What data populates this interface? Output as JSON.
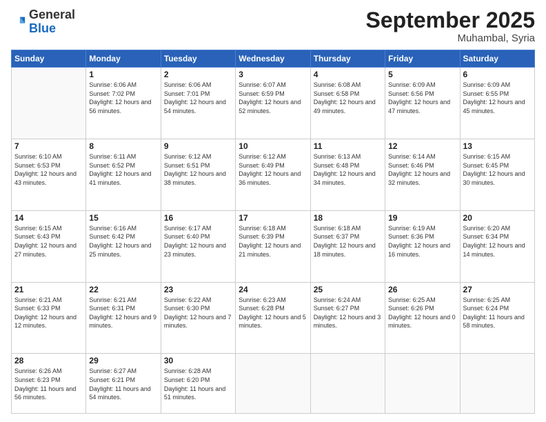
{
  "logo": {
    "general": "General",
    "blue": "Blue"
  },
  "header": {
    "month": "September 2025",
    "location": "Muhambal, Syria"
  },
  "weekdays": [
    "Sunday",
    "Monday",
    "Tuesday",
    "Wednesday",
    "Thursday",
    "Friday",
    "Saturday"
  ],
  "weeks": [
    [
      {
        "day": "",
        "sunrise": "",
        "sunset": "",
        "daylight": ""
      },
      {
        "day": "1",
        "sunrise": "6:06 AM",
        "sunset": "7:02 PM",
        "daylight": "12 hours and 56 minutes."
      },
      {
        "day": "2",
        "sunrise": "6:06 AM",
        "sunset": "7:01 PM",
        "daylight": "12 hours and 54 minutes."
      },
      {
        "day": "3",
        "sunrise": "6:07 AM",
        "sunset": "6:59 PM",
        "daylight": "12 hours and 52 minutes."
      },
      {
        "day": "4",
        "sunrise": "6:08 AM",
        "sunset": "6:58 PM",
        "daylight": "12 hours and 49 minutes."
      },
      {
        "day": "5",
        "sunrise": "6:09 AM",
        "sunset": "6:56 PM",
        "daylight": "12 hours and 47 minutes."
      },
      {
        "day": "6",
        "sunrise": "6:09 AM",
        "sunset": "6:55 PM",
        "daylight": "12 hours and 45 minutes."
      }
    ],
    [
      {
        "day": "7",
        "sunrise": "6:10 AM",
        "sunset": "6:53 PM",
        "daylight": "12 hours and 43 minutes."
      },
      {
        "day": "8",
        "sunrise": "6:11 AM",
        "sunset": "6:52 PM",
        "daylight": "12 hours and 41 minutes."
      },
      {
        "day": "9",
        "sunrise": "6:12 AM",
        "sunset": "6:51 PM",
        "daylight": "12 hours and 38 minutes."
      },
      {
        "day": "10",
        "sunrise": "6:12 AM",
        "sunset": "6:49 PM",
        "daylight": "12 hours and 36 minutes."
      },
      {
        "day": "11",
        "sunrise": "6:13 AM",
        "sunset": "6:48 PM",
        "daylight": "12 hours and 34 minutes."
      },
      {
        "day": "12",
        "sunrise": "6:14 AM",
        "sunset": "6:46 PM",
        "daylight": "12 hours and 32 minutes."
      },
      {
        "day": "13",
        "sunrise": "6:15 AM",
        "sunset": "6:45 PM",
        "daylight": "12 hours and 30 minutes."
      }
    ],
    [
      {
        "day": "14",
        "sunrise": "6:15 AM",
        "sunset": "6:43 PM",
        "daylight": "12 hours and 27 minutes."
      },
      {
        "day": "15",
        "sunrise": "6:16 AM",
        "sunset": "6:42 PM",
        "daylight": "12 hours and 25 minutes."
      },
      {
        "day": "16",
        "sunrise": "6:17 AM",
        "sunset": "6:40 PM",
        "daylight": "12 hours and 23 minutes."
      },
      {
        "day": "17",
        "sunrise": "6:18 AM",
        "sunset": "6:39 PM",
        "daylight": "12 hours and 21 minutes."
      },
      {
        "day": "18",
        "sunrise": "6:18 AM",
        "sunset": "6:37 PM",
        "daylight": "12 hours and 18 minutes."
      },
      {
        "day": "19",
        "sunrise": "6:19 AM",
        "sunset": "6:36 PM",
        "daylight": "12 hours and 16 minutes."
      },
      {
        "day": "20",
        "sunrise": "6:20 AM",
        "sunset": "6:34 PM",
        "daylight": "12 hours and 14 minutes."
      }
    ],
    [
      {
        "day": "21",
        "sunrise": "6:21 AM",
        "sunset": "6:33 PM",
        "daylight": "12 hours and 12 minutes."
      },
      {
        "day": "22",
        "sunrise": "6:21 AM",
        "sunset": "6:31 PM",
        "daylight": "12 hours and 9 minutes."
      },
      {
        "day": "23",
        "sunrise": "6:22 AM",
        "sunset": "6:30 PM",
        "daylight": "12 hours and 7 minutes."
      },
      {
        "day": "24",
        "sunrise": "6:23 AM",
        "sunset": "6:28 PM",
        "daylight": "12 hours and 5 minutes."
      },
      {
        "day": "25",
        "sunrise": "6:24 AM",
        "sunset": "6:27 PM",
        "daylight": "12 hours and 3 minutes."
      },
      {
        "day": "26",
        "sunrise": "6:25 AM",
        "sunset": "6:26 PM",
        "daylight": "12 hours and 0 minutes."
      },
      {
        "day": "27",
        "sunrise": "6:25 AM",
        "sunset": "6:24 PM",
        "daylight": "11 hours and 58 minutes."
      }
    ],
    [
      {
        "day": "28",
        "sunrise": "6:26 AM",
        "sunset": "6:23 PM",
        "daylight": "11 hours and 56 minutes."
      },
      {
        "day": "29",
        "sunrise": "6:27 AM",
        "sunset": "6:21 PM",
        "daylight": "11 hours and 54 minutes."
      },
      {
        "day": "30",
        "sunrise": "6:28 AM",
        "sunset": "6:20 PM",
        "daylight": "11 hours and 51 minutes."
      },
      {
        "day": "",
        "sunrise": "",
        "sunset": "",
        "daylight": ""
      },
      {
        "day": "",
        "sunrise": "",
        "sunset": "",
        "daylight": ""
      },
      {
        "day": "",
        "sunrise": "",
        "sunset": "",
        "daylight": ""
      },
      {
        "day": "",
        "sunrise": "",
        "sunset": "",
        "daylight": ""
      }
    ]
  ],
  "labels": {
    "sunrise": "Sunrise:",
    "sunset": "Sunset:",
    "daylight": "Daylight:"
  }
}
